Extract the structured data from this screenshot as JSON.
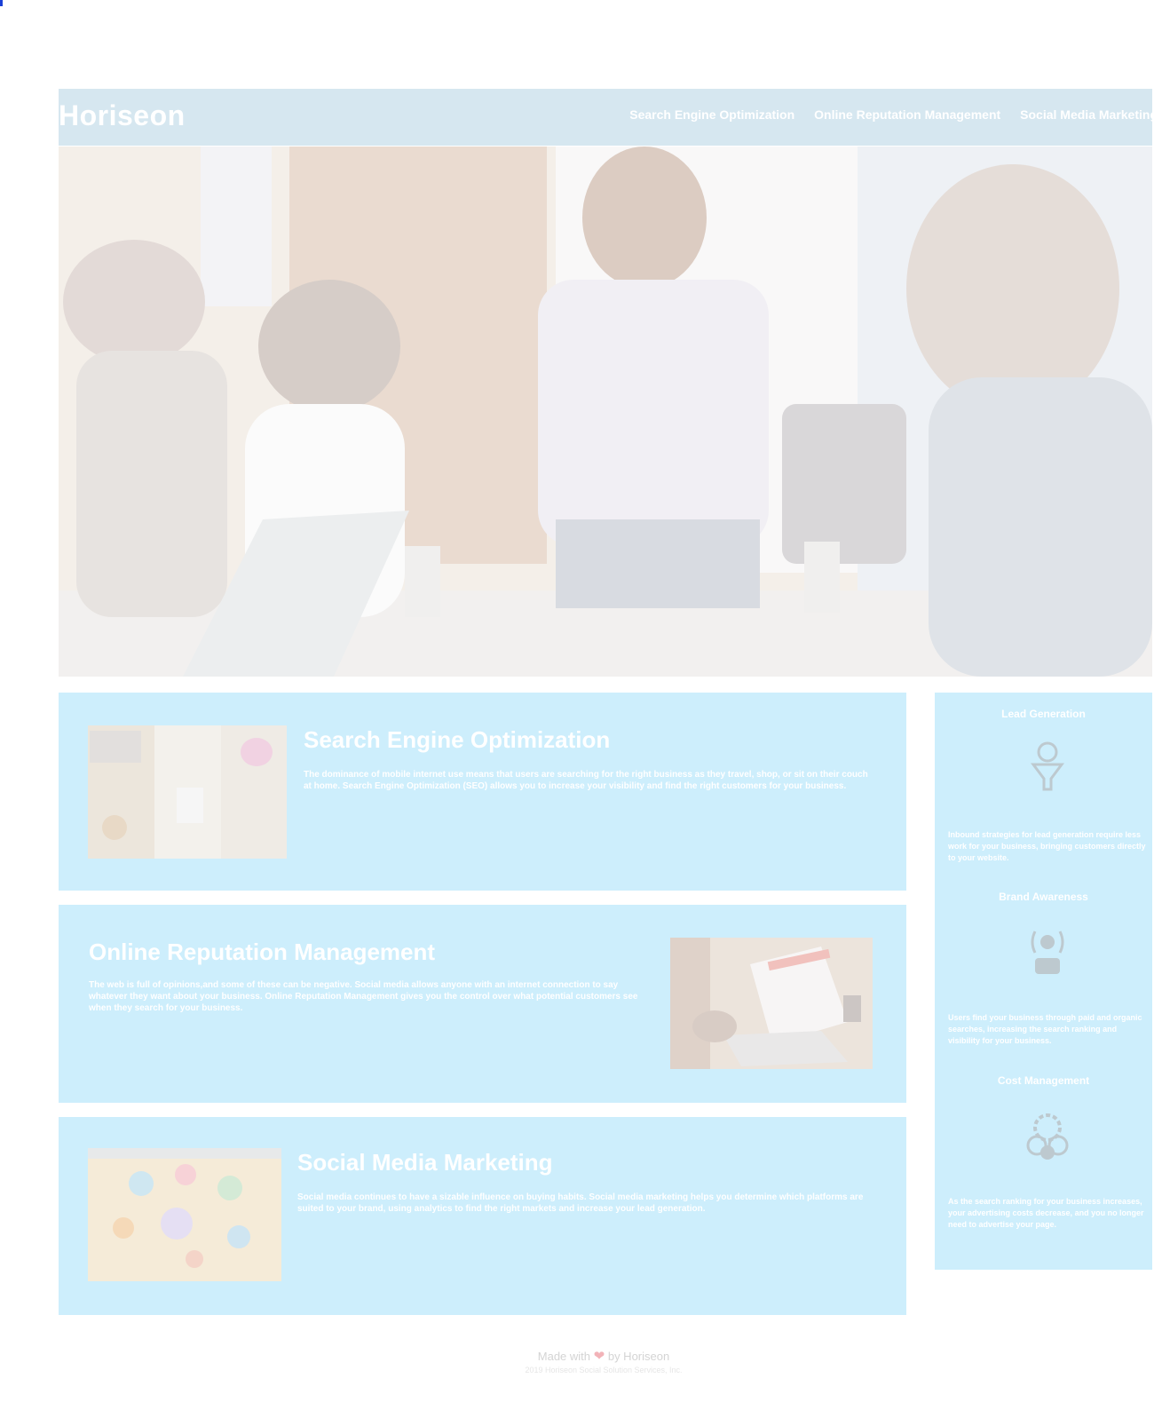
{
  "header": {
    "logo": "Horiseon",
    "nav": [
      "Search Engine Optimization",
      "Online Reputation Management",
      "Social Media Marketing"
    ]
  },
  "hero": {
    "image": "team-meeting-photo"
  },
  "content": [
    {
      "id": "search-engine-optimization",
      "title": "Search Engine Optimization",
      "text": "The dominance of mobile internet use means that users are searching for the right business as they travel, shop, or sit on their couch at home. Search Engine Optimization (SEO) allows you to increase your visibility and find the right customers for your business.",
      "image": "seo-desk-photo"
    },
    {
      "id": "online-reputation-management",
      "title": "Online Reputation Management",
      "text": "The web is full of opinions,and some of these can be negative. Social media allows anyone with an internet connection to say whatever they want about your business. Online Reputation Management gives you the control over what potential customers see when they search for your business.",
      "image": "laptop-analytics-photo"
    },
    {
      "id": "social-media-marketing",
      "title": "Social Media Marketing",
      "text": "Social media continues to have a sizable influence on buying habits. Social media marketing helps you determine which platforms are suited to your brand, using analytics to find the right markets and increase your lead generation.",
      "image": "social-icons-photo"
    }
  ],
  "benefits": [
    {
      "title": "Lead Generation",
      "icon": "lead-funnel-icon",
      "text": "Inbound strategies for lead generation require less work for your business, bringing customers directly to your website."
    },
    {
      "title": "Brand Awareness",
      "icon": "brand-broadcast-icon",
      "text": "Users find your business through paid and organic searches, increasing the search ranking and visibility for your business."
    },
    {
      "title": "Cost Management",
      "icon": "cost-gears-icon",
      "text": "As the search ranking for your business increases, your advertising costs decrease, and you no longer need to advertise your page."
    }
  ],
  "footer": {
    "made_prefix": "Made with",
    "heart": "❤",
    "made_suffix": "by Horiseon",
    "copyright": "2019 Horiseon Social Solution Services, Inc."
  }
}
